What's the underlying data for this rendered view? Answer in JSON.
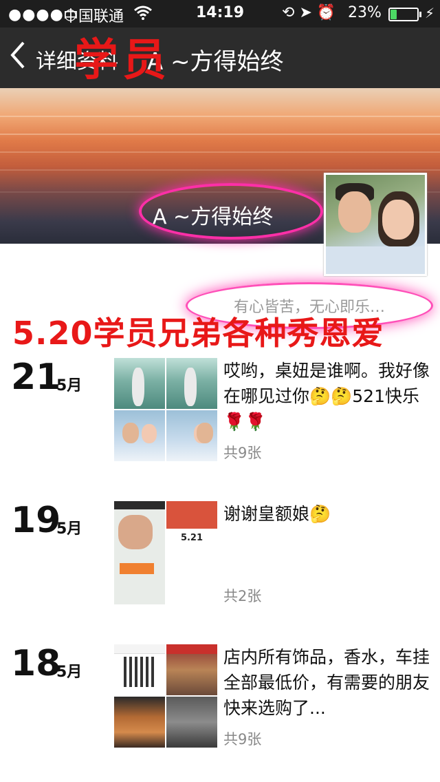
{
  "status_bar": {
    "signal": "●●●●○",
    "carrier": "中国联通",
    "time": "14:19",
    "battery_percent": "23%",
    "battery_level": 0.23
  },
  "nav": {
    "back_label": "详细资料",
    "title": "A ~方得始终"
  },
  "overlay_top": "学员",
  "profile": {
    "name": "A ~方得始终",
    "signature": "有心皆苦，无心即乐…"
  },
  "overlay_banner": "5.20学员兄弟各种秀恩爱",
  "posts": [
    {
      "day": "21",
      "month": "5月",
      "text": "哎哟，桌妞是谁啊。我好像在哪见过你🤔🤔521快乐🌹🌹",
      "count": "共9张"
    },
    {
      "day": "19",
      "month": "5月",
      "text": "谢谢皇额娘🤔",
      "count": "共2张",
      "thumb_amount": "5.21"
    },
    {
      "day": "18",
      "month": "5月",
      "text": "店内所有饰品，香水，车挂全部最低价，有需要的朋友快来选购了...",
      "count": "共9张"
    }
  ]
}
